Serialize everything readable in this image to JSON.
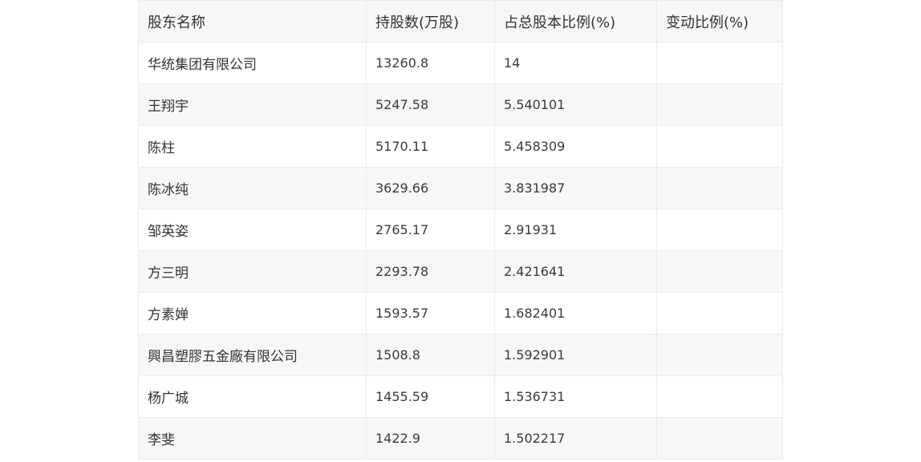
{
  "table": {
    "headers": [
      "股东名称",
      "持股数(万股)",
      "占总股本比例(%)",
      "变动比例(%)"
    ],
    "rows": [
      [
        "华统集团有限公司",
        "13260.8",
        "14",
        ""
      ],
      [
        "王翔宇",
        "5247.58",
        "5.540101",
        ""
      ],
      [
        "陈柱",
        "5170.11",
        "5.458309",
        ""
      ],
      [
        "陈冰纯",
        "3629.66",
        "3.831987",
        ""
      ],
      [
        "邹英姿",
        "2765.17",
        "2.91931",
        ""
      ],
      [
        "方三明",
        "2293.78",
        "2.421641",
        ""
      ],
      [
        "方素婵",
        "1593.57",
        "1.682401",
        ""
      ],
      [
        "興昌塑膠五金廠有限公司",
        "1508.8",
        "1.592901",
        ""
      ],
      [
        "杨广城",
        "1455.59",
        "1.536731",
        ""
      ],
      [
        "李斐",
        "1422.9",
        "1.502217",
        ""
      ]
    ]
  }
}
